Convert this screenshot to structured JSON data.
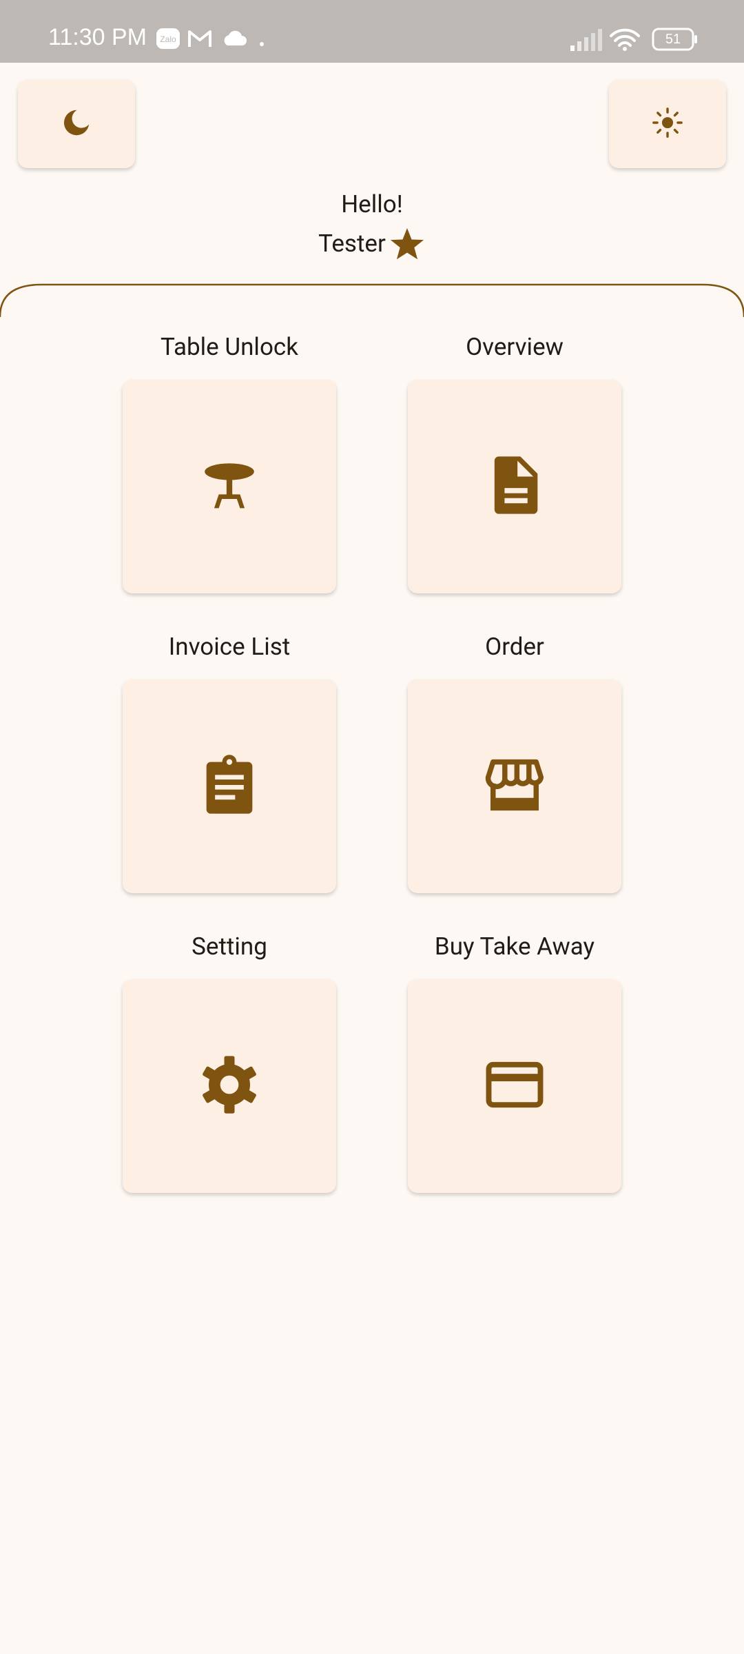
{
  "status_bar": {
    "time": "11:30 PM",
    "battery": "51",
    "icons": [
      "zalo-icon",
      "gmail-icon",
      "cloud-icon",
      "dot-icon",
      "signal-icon",
      "wifi-icon",
      "battery-icon"
    ]
  },
  "theme": {
    "dark_mode_icon": "moon-icon",
    "light_mode_icon": "sun-icon",
    "accent": "#7f5410",
    "tile_bg": "#fdefe4",
    "page_bg": "#fdf8f3"
  },
  "header": {
    "greeting": "Hello!",
    "username": "Tester",
    "badge_icon": "star-icon"
  },
  "menu": [
    {
      "label": "Table Unlock",
      "icon": "table-icon"
    },
    {
      "label": "Overview",
      "icon": "document-icon"
    },
    {
      "label": "Invoice List",
      "icon": "clipboard-icon"
    },
    {
      "label": "Order",
      "icon": "store-icon"
    },
    {
      "label": "Setting",
      "icon": "gear-icon"
    },
    {
      "label": "Buy Take Away",
      "icon": "credit-card-icon"
    }
  ]
}
